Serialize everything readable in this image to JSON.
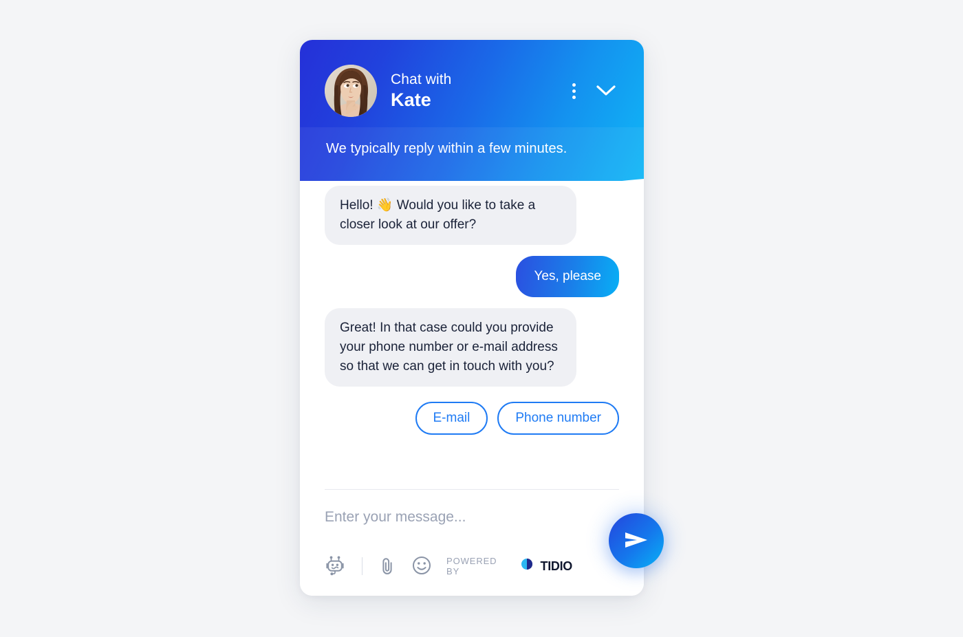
{
  "background_color": "#f4f5f7",
  "widget": {
    "accent_color": "#1f7bf4",
    "header": {
      "gradient_from": "#2530d8",
      "gradient_to": "#10b7f6",
      "title_small": "Chat with",
      "title_big": "Kate",
      "avatar_name": "agent-avatar-photo",
      "menu_icon": "three-dots-vertical-icon",
      "minimize_icon": "chevron-down-icon",
      "subtitle": "We typically reply within a few minutes."
    },
    "messages": [
      {
        "from": "agent",
        "text": "Hello! 👋 Would you like to take a closer look at our offer?"
      },
      {
        "from": "user",
        "text": "Yes, please"
      },
      {
        "from": "agent",
        "text": "Great! In that case could you provide your phone number or e-mail address so that we can get in touch with you?"
      }
    ],
    "quick_replies": [
      {
        "label": "E-mail"
      },
      {
        "label": "Phone number"
      }
    ],
    "composer": {
      "placeholder": "Enter your message...",
      "value": "",
      "tools": [
        {
          "icon": "bot-icon",
          "label": "Chatbot"
        },
        {
          "icon": "paperclip-icon",
          "label": "Attach file"
        },
        {
          "icon": "emoji-smiley-icon",
          "label": "Emoji"
        }
      ],
      "send_icon": "send-paper-plane-icon",
      "send_label": "Send"
    },
    "branding": {
      "powered_by_text": "POWERED BY",
      "brand_name": "TIDIO",
      "logo_icon": "tidio-logo-icon",
      "logo_dark": "#1f2a8c",
      "logo_light": "#2bb7f2"
    }
  }
}
